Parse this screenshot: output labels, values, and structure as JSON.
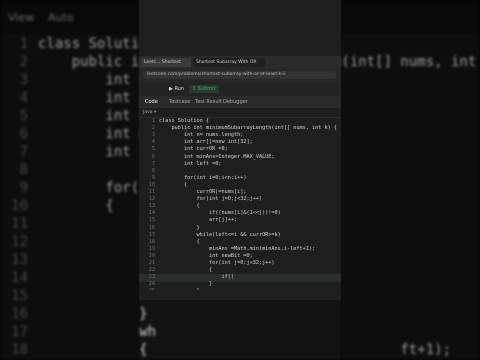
{
  "background": {
    "title_left": "View",
    "title_right": "Auto",
    "lines": [
      {
        "num": "1",
        "text": "class Solution {"
      },
      {
        "num": "2",
        "text": "    public int minimumSubarrayLength(int[] nums, int k) {"
      },
      {
        "num": "3",
        "text": "        int n="
      },
      {
        "num": "4",
        "text": "        int ar"
      },
      {
        "num": "5",
        "text": "        int cu"
      },
      {
        "num": "6",
        "text": "        int mi"
      },
      {
        "num": "7",
        "text": "        int le"
      },
      {
        "num": "8",
        "text": ""
      },
      {
        "num": "9",
        "text": "        for(in"
      },
      {
        "num": "10",
        "text": "        {"
      },
      {
        "num": "11",
        "text": "            cu"
      },
      {
        "num": "12",
        "text": "            fo"
      },
      {
        "num": "13",
        "text": "            {"
      },
      {
        "num": "14",
        "text": ""
      },
      {
        "num": "15",
        "text": ""
      },
      {
        "num": "16",
        "text": "            }"
      },
      {
        "num": "17",
        "text": "            wh"
      },
      {
        "num": "18",
        "text": "            {                              ft+1);"
      }
    ]
  },
  "browser": {
    "tab1": "Leetc... Shortest Subarr...",
    "tab2": "Shortest Subarray With OR at...",
    "address": "leetcode.com/problems/shortest-subarray-with-or-at-least-k-ii"
  },
  "leetcode": {
    "run_label": "Run",
    "submit_label": "Submit",
    "tabs": [
      "Code",
      "Testcase",
      "Test Result",
      "Debugger"
    ],
    "language": "Java"
  },
  "code_lines": [
    {
      "num": "1",
      "text": "class Solution {"
    },
    {
      "num": "2",
      "text": "    public int minimumSubarrayLength(int[] nums, int k) {"
    },
    {
      "num": "3",
      "text": "        int n= nums.length;"
    },
    {
      "num": "4",
      "text": "        int arr[]=new int[32];"
    },
    {
      "num": "5",
      "text": "        int currOR =0;"
    },
    {
      "num": "6",
      "text": "        int minAns=Integer.MAX_VALUE;"
    },
    {
      "num": "7",
      "text": "        int left =0;"
    },
    {
      "num": "8",
      "text": ""
    },
    {
      "num": "9",
      "text": "        for(int i=0;i<n;i++)"
    },
    {
      "num": "10",
      "text": "        {"
    },
    {
      "num": "11",
      "text": "            currOR|=nums[i];"
    },
    {
      "num": "12",
      "text": "            for(int j=0;j<32;j++)"
    },
    {
      "num": "13",
      "text": "            {"
    },
    {
      "num": "14",
      "text": "                if((nums[i]&(1<<j))!=0)"
    },
    {
      "num": "15",
      "text": "                arr[j]++;"
    },
    {
      "num": "16",
      "text": "            }"
    },
    {
      "num": "17",
      "text": "            while(left<=i && currOR>=k)"
    },
    {
      "num": "18",
      "text": "            {"
    },
    {
      "num": "19",
      "text": "                minAns =Math.min(minAns,i-left+1);"
    },
    {
      "num": "20",
      "text": "                int newBit =0;"
    },
    {
      "num": "21",
      "text": "                for(int j=0;j<32;j++)"
    },
    {
      "num": "22",
      "text": "                {"
    },
    {
      "num": "23",
      "text": "                    if()"
    },
    {
      "num": "24",
      "text": "                }"
    },
    {
      "num": "25",
      "text": "            }"
    }
  ]
}
